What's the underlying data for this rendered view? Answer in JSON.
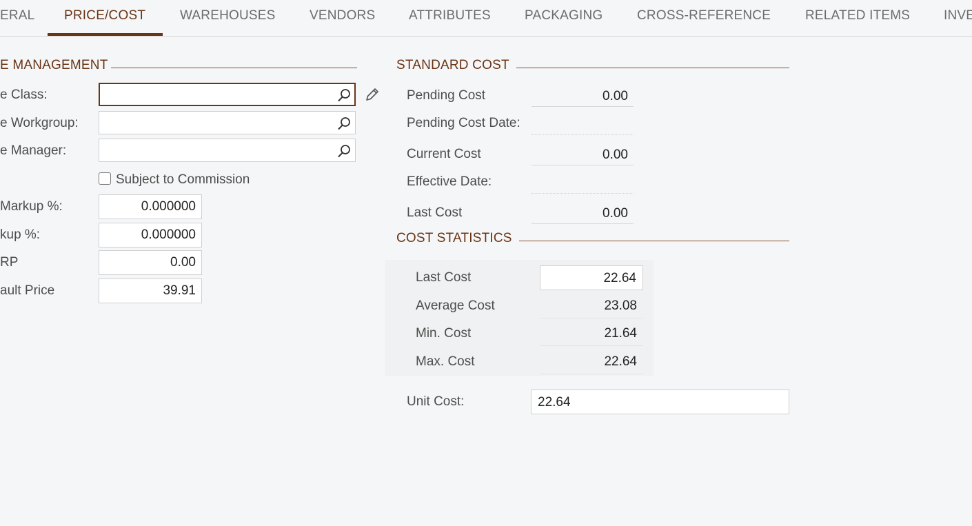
{
  "tabs": [
    {
      "label": "ERAL"
    },
    {
      "label": "PRICE/COST"
    },
    {
      "label": "WAREHOUSES"
    },
    {
      "label": "VENDORS"
    },
    {
      "label": "ATTRIBUTES"
    },
    {
      "label": "PACKAGING"
    },
    {
      "label": "CROSS-REFERENCE"
    },
    {
      "label": "RELATED ITEMS"
    },
    {
      "label": "INVE"
    }
  ],
  "active_tab": "PRICE/COST",
  "price_management": {
    "title": "E MANAGEMENT",
    "price_class_label": "e Class:",
    "price_class_value": "",
    "workgroup_label": "e Workgroup:",
    "workgroup_value": "",
    "manager_label": "e Manager:",
    "manager_value": "",
    "commission_label": "Subject to Commission",
    "commission_checked": false,
    "min_markup_label": "Markup %:",
    "min_markup_value": "0.000000",
    "markup_label": "kup %:",
    "markup_value": "0.000000",
    "msrp_label": "RP",
    "msrp_value": "0.00",
    "default_price_label": "ault Price",
    "default_price_value": "39.91"
  },
  "standard_cost": {
    "title": "STANDARD COST",
    "pending_cost_label": "Pending Cost",
    "pending_cost_value": "0.00",
    "pending_cost_date_label": "Pending Cost Date:",
    "pending_cost_date_value": "",
    "current_cost_label": "Current Cost",
    "current_cost_value": "0.00",
    "effective_date_label": "Effective Date:",
    "effective_date_value": "",
    "last_cost_label": "Last Cost",
    "last_cost_value": "0.00"
  },
  "cost_statistics": {
    "title": "COST STATISTICS",
    "last_cost_label": "Last Cost",
    "last_cost_value": "22.64",
    "average_cost_label": "Average Cost",
    "average_cost_value": "23.08",
    "min_cost_label": "Min. Cost",
    "min_cost_value": "21.64",
    "max_cost_label": "Max. Cost",
    "max_cost_value": "22.64",
    "unit_cost_label": "Unit Cost:",
    "unit_cost_value": "22.64"
  },
  "colors": {
    "accent": "#6a3416",
    "background": "#f5f6f7"
  },
  "icons": [
    "search-icon",
    "pencil-icon"
  ]
}
